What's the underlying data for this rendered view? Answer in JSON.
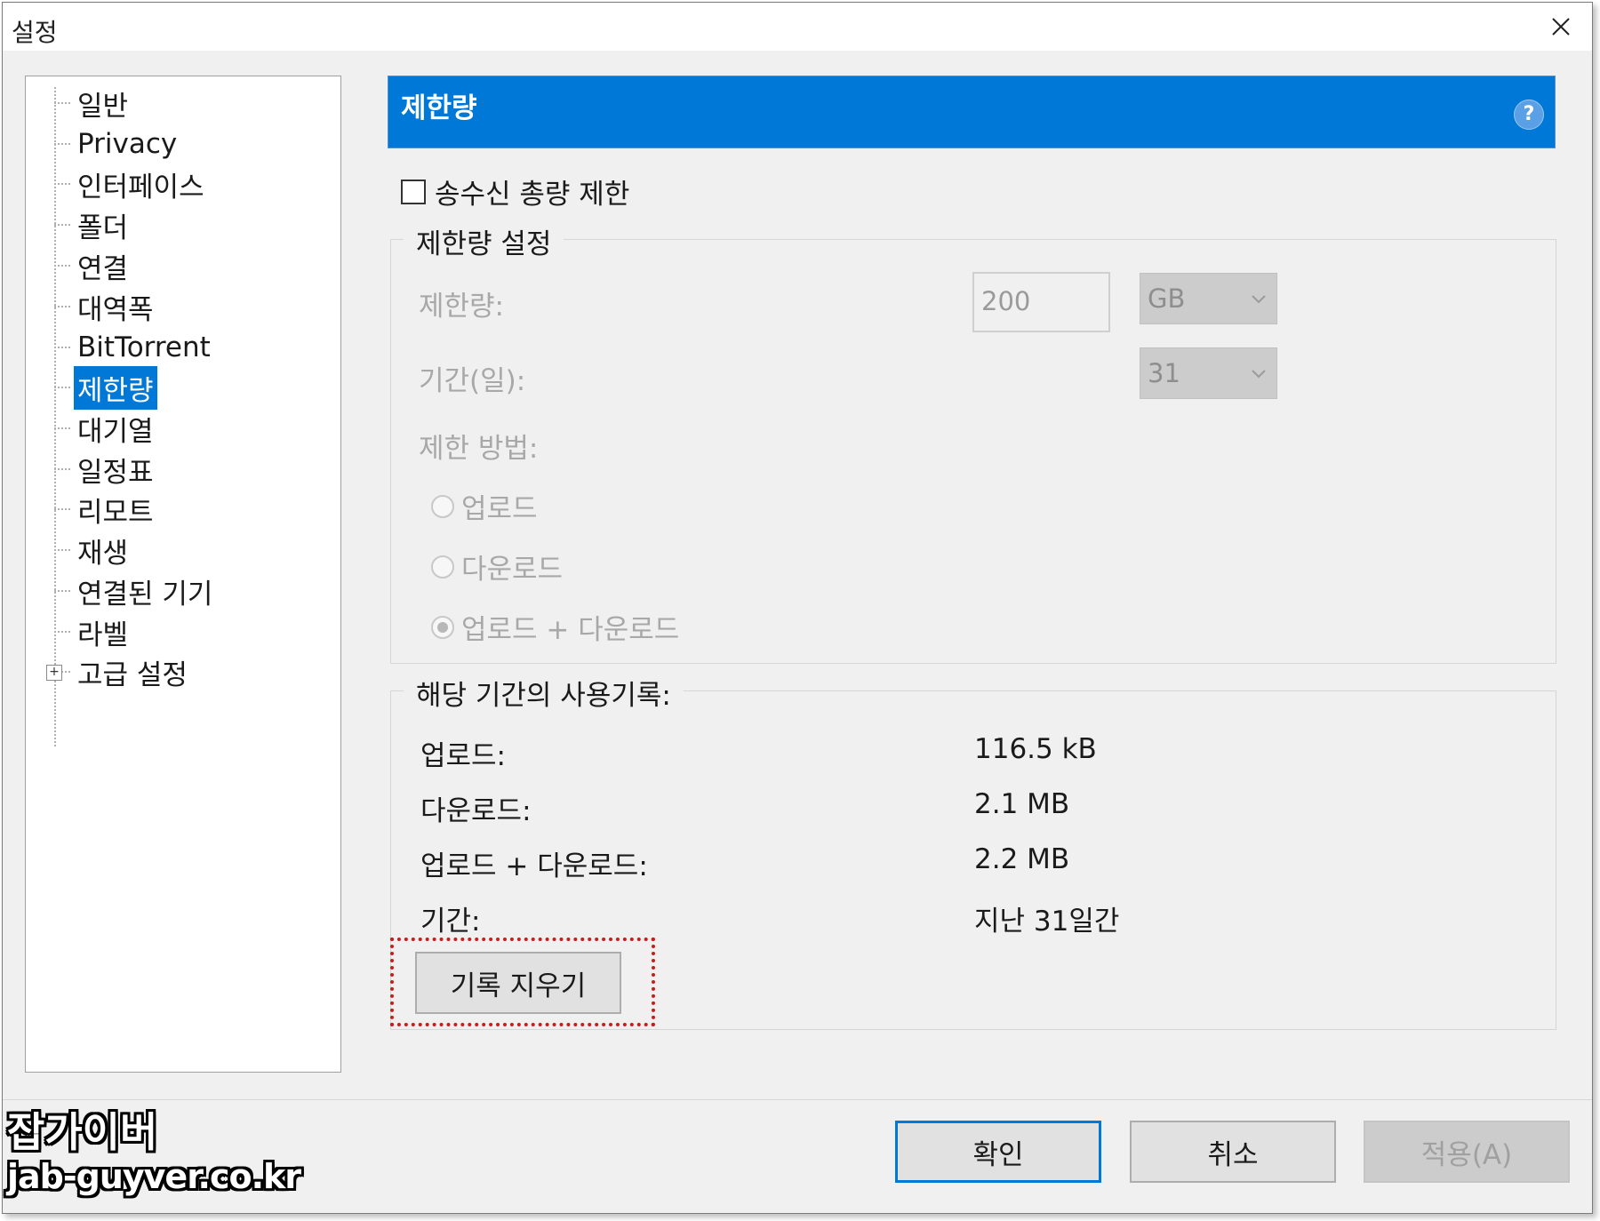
{
  "window": {
    "title": "설정"
  },
  "tree": {
    "items": [
      {
        "label": "일반"
      },
      {
        "label": "Privacy"
      },
      {
        "label": "인터페이스"
      },
      {
        "label": "폴더"
      },
      {
        "label": "연결"
      },
      {
        "label": "대역폭"
      },
      {
        "label": "BitTorrent"
      },
      {
        "label": "제한량"
      },
      {
        "label": "대기열"
      },
      {
        "label": "일정표"
      },
      {
        "label": "리모트"
      },
      {
        "label": "재생"
      },
      {
        "label": "연결된 기기"
      },
      {
        "label": "라벨"
      },
      {
        "label": "고급 설정"
      }
    ],
    "selected": "제한량"
  },
  "panel": {
    "title": "제한량",
    "help_glyph": "?",
    "enable_checkbox": {
      "label": "송수신 총량 제한",
      "checked": false
    },
    "limit_group": {
      "legend": "제한량 설정",
      "amount_label": "제한량:",
      "amount_value": "200",
      "amount_unit": "GB",
      "period_label": "기간(일):",
      "period_value": "31",
      "method_label": "제한 방법:",
      "methods": [
        "업로드",
        "다운로드",
        "업로드 + 다운로드"
      ],
      "selected_method": "업로드 + 다운로드"
    },
    "usage_group": {
      "legend": "해당 기간의 사용기록:",
      "rows": [
        {
          "label": "업로드:",
          "value": "116.5 kB"
        },
        {
          "label": "다운로드:",
          "value": "2.1 MB"
        },
        {
          "label": "업로드 + 다운로드:",
          "value": "2.2 MB"
        },
        {
          "label": "기간:",
          "value": "지난 31일간"
        }
      ],
      "clear_button": "기록 지우기"
    }
  },
  "footer": {
    "ok": "확인",
    "cancel": "취소",
    "apply": "적용(A)"
  },
  "watermark": {
    "line1": "잡가이버",
    "line2": "jab-guyver.co.kr"
  },
  "colors": {
    "accent": "#0078d7",
    "highlight_border": "#d0191f"
  }
}
